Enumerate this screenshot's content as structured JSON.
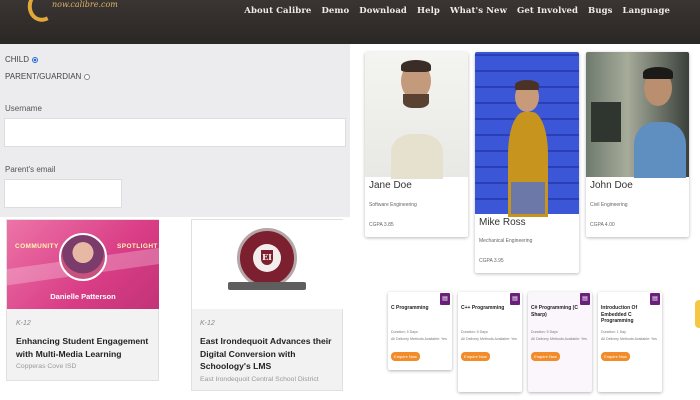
{
  "header": {
    "logo_text": "now.calibre.com",
    "nav": [
      "About Calibre",
      "Demo",
      "Download",
      "Help",
      "What's New",
      "Get Involved",
      "Bugs",
      "Language"
    ]
  },
  "form": {
    "child_label": "CHILD",
    "parent_label": "PARENT/GUARDIAN",
    "username_label": "Username",
    "username_value": "",
    "parent_email_label": "Parent's email",
    "parent_email_value": ""
  },
  "community_cards": [
    {
      "tag_left": "COMMUNITY",
      "tag_right": "SPOTLIGHT",
      "banner_name": "Danielle Patterson",
      "category": "K-12",
      "title": "Enhancing Student Engagement with Multi-Media Learning",
      "subtitle": "Copperas Cove ISD"
    },
    {
      "seal_letter": "EI",
      "category": "K-12",
      "title": "East Irondequoit Advances their Digital Conversion with Schoology's LMS",
      "subtitle": "East Irondequoit Central School District"
    }
  ],
  "profiles": [
    {
      "name": "Jane Doe",
      "role": "Software Engineering",
      "gpa": "CGPA 3.85"
    },
    {
      "name": "Mike Ross",
      "role": "Mechanical Engineering",
      "gpa": "CGPA 3.95"
    },
    {
      "name": "John Doe",
      "role": "Civil Engineering",
      "gpa": "CGPA 4.00"
    }
  ],
  "courses": [
    {
      "title": "C Programming",
      "duration": "Duration: 5 Days",
      "delivery": "All Delivery Methods Available: Yes",
      "button": "Enquire Now"
    },
    {
      "title": "C++ Programming",
      "duration": "Duration: 5 Days",
      "delivery": "All Delivery Methods Available: Yes",
      "button": "Enquire Now"
    },
    {
      "title": "C# Programming (C Sharp)",
      "duration": "Duration: 5 Days",
      "delivery": "All Delivery Methods Available: Yes",
      "button": "Enquire Now"
    },
    {
      "title": "Introduction Of Embedded C Programming",
      "duration": "Duration: 1 Day",
      "delivery": "All Delivery Methods Available: Yes",
      "button": "Enquire Now"
    }
  ],
  "colors": {
    "header_bg": "#2b2724",
    "accent_orange": "#f28b2a",
    "course_badge": "#6a1f7a",
    "spotlight_pink": "#d93d86"
  }
}
